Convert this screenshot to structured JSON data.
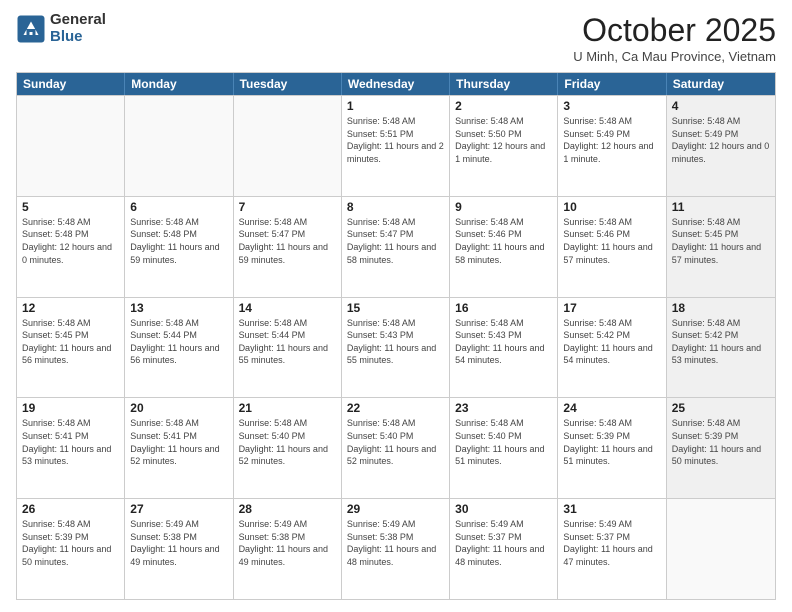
{
  "logo": {
    "general": "General",
    "blue": "Blue"
  },
  "title": "October 2025",
  "location": "U Minh, Ca Mau Province, Vietnam",
  "days_of_week": [
    "Sunday",
    "Monday",
    "Tuesday",
    "Wednesday",
    "Thursday",
    "Friday",
    "Saturday"
  ],
  "rows": [
    [
      {
        "day": "",
        "sunrise": "",
        "sunset": "",
        "daylight": "",
        "shaded": false,
        "empty": true
      },
      {
        "day": "",
        "sunrise": "",
        "sunset": "",
        "daylight": "",
        "shaded": false,
        "empty": true
      },
      {
        "day": "",
        "sunrise": "",
        "sunset": "",
        "daylight": "",
        "shaded": false,
        "empty": true
      },
      {
        "day": "1",
        "sunrise": "Sunrise: 5:48 AM",
        "sunset": "Sunset: 5:51 PM",
        "daylight": "Daylight: 11 hours and 2 minutes.",
        "shaded": false,
        "empty": false
      },
      {
        "day": "2",
        "sunrise": "Sunrise: 5:48 AM",
        "sunset": "Sunset: 5:50 PM",
        "daylight": "Daylight: 12 hours and 1 minute.",
        "shaded": false,
        "empty": false
      },
      {
        "day": "3",
        "sunrise": "Sunrise: 5:48 AM",
        "sunset": "Sunset: 5:49 PM",
        "daylight": "Daylight: 12 hours and 1 minute.",
        "shaded": false,
        "empty": false
      },
      {
        "day": "4",
        "sunrise": "Sunrise: 5:48 AM",
        "sunset": "Sunset: 5:49 PM",
        "daylight": "Daylight: 12 hours and 0 minutes.",
        "shaded": true,
        "empty": false
      }
    ],
    [
      {
        "day": "5",
        "sunrise": "Sunrise: 5:48 AM",
        "sunset": "Sunset: 5:48 PM",
        "daylight": "Daylight: 12 hours and 0 minutes.",
        "shaded": false,
        "empty": false
      },
      {
        "day": "6",
        "sunrise": "Sunrise: 5:48 AM",
        "sunset": "Sunset: 5:48 PM",
        "daylight": "Daylight: 11 hours and 59 minutes.",
        "shaded": false,
        "empty": false
      },
      {
        "day": "7",
        "sunrise": "Sunrise: 5:48 AM",
        "sunset": "Sunset: 5:47 PM",
        "daylight": "Daylight: 11 hours and 59 minutes.",
        "shaded": false,
        "empty": false
      },
      {
        "day": "8",
        "sunrise": "Sunrise: 5:48 AM",
        "sunset": "Sunset: 5:47 PM",
        "daylight": "Daylight: 11 hours and 58 minutes.",
        "shaded": false,
        "empty": false
      },
      {
        "day": "9",
        "sunrise": "Sunrise: 5:48 AM",
        "sunset": "Sunset: 5:46 PM",
        "daylight": "Daylight: 11 hours and 58 minutes.",
        "shaded": false,
        "empty": false
      },
      {
        "day": "10",
        "sunrise": "Sunrise: 5:48 AM",
        "sunset": "Sunset: 5:46 PM",
        "daylight": "Daylight: 11 hours and 57 minutes.",
        "shaded": false,
        "empty": false
      },
      {
        "day": "11",
        "sunrise": "Sunrise: 5:48 AM",
        "sunset": "Sunset: 5:45 PM",
        "daylight": "Daylight: 11 hours and 57 minutes.",
        "shaded": true,
        "empty": false
      }
    ],
    [
      {
        "day": "12",
        "sunrise": "Sunrise: 5:48 AM",
        "sunset": "Sunset: 5:45 PM",
        "daylight": "Daylight: 11 hours and 56 minutes.",
        "shaded": false,
        "empty": false
      },
      {
        "day": "13",
        "sunrise": "Sunrise: 5:48 AM",
        "sunset": "Sunset: 5:44 PM",
        "daylight": "Daylight: 11 hours and 56 minutes.",
        "shaded": false,
        "empty": false
      },
      {
        "day": "14",
        "sunrise": "Sunrise: 5:48 AM",
        "sunset": "Sunset: 5:44 PM",
        "daylight": "Daylight: 11 hours and 55 minutes.",
        "shaded": false,
        "empty": false
      },
      {
        "day": "15",
        "sunrise": "Sunrise: 5:48 AM",
        "sunset": "Sunset: 5:43 PM",
        "daylight": "Daylight: 11 hours and 55 minutes.",
        "shaded": false,
        "empty": false
      },
      {
        "day": "16",
        "sunrise": "Sunrise: 5:48 AM",
        "sunset": "Sunset: 5:43 PM",
        "daylight": "Daylight: 11 hours and 54 minutes.",
        "shaded": false,
        "empty": false
      },
      {
        "day": "17",
        "sunrise": "Sunrise: 5:48 AM",
        "sunset": "Sunset: 5:42 PM",
        "daylight": "Daylight: 11 hours and 54 minutes.",
        "shaded": false,
        "empty": false
      },
      {
        "day": "18",
        "sunrise": "Sunrise: 5:48 AM",
        "sunset": "Sunset: 5:42 PM",
        "daylight": "Daylight: 11 hours and 53 minutes.",
        "shaded": true,
        "empty": false
      }
    ],
    [
      {
        "day": "19",
        "sunrise": "Sunrise: 5:48 AM",
        "sunset": "Sunset: 5:41 PM",
        "daylight": "Daylight: 11 hours and 53 minutes.",
        "shaded": false,
        "empty": false
      },
      {
        "day": "20",
        "sunrise": "Sunrise: 5:48 AM",
        "sunset": "Sunset: 5:41 PM",
        "daylight": "Daylight: 11 hours and 52 minutes.",
        "shaded": false,
        "empty": false
      },
      {
        "day": "21",
        "sunrise": "Sunrise: 5:48 AM",
        "sunset": "Sunset: 5:40 PM",
        "daylight": "Daylight: 11 hours and 52 minutes.",
        "shaded": false,
        "empty": false
      },
      {
        "day": "22",
        "sunrise": "Sunrise: 5:48 AM",
        "sunset": "Sunset: 5:40 PM",
        "daylight": "Daylight: 11 hours and 52 minutes.",
        "shaded": false,
        "empty": false
      },
      {
        "day": "23",
        "sunrise": "Sunrise: 5:48 AM",
        "sunset": "Sunset: 5:40 PM",
        "daylight": "Daylight: 11 hours and 51 minutes.",
        "shaded": false,
        "empty": false
      },
      {
        "day": "24",
        "sunrise": "Sunrise: 5:48 AM",
        "sunset": "Sunset: 5:39 PM",
        "daylight": "Daylight: 11 hours and 51 minutes.",
        "shaded": false,
        "empty": false
      },
      {
        "day": "25",
        "sunrise": "Sunrise: 5:48 AM",
        "sunset": "Sunset: 5:39 PM",
        "daylight": "Daylight: 11 hours and 50 minutes.",
        "shaded": true,
        "empty": false
      }
    ],
    [
      {
        "day": "26",
        "sunrise": "Sunrise: 5:48 AM",
        "sunset": "Sunset: 5:39 PM",
        "daylight": "Daylight: 11 hours and 50 minutes.",
        "shaded": false,
        "empty": false
      },
      {
        "day": "27",
        "sunrise": "Sunrise: 5:49 AM",
        "sunset": "Sunset: 5:38 PM",
        "daylight": "Daylight: 11 hours and 49 minutes.",
        "shaded": false,
        "empty": false
      },
      {
        "day": "28",
        "sunrise": "Sunrise: 5:49 AM",
        "sunset": "Sunset: 5:38 PM",
        "daylight": "Daylight: 11 hours and 49 minutes.",
        "shaded": false,
        "empty": false
      },
      {
        "day": "29",
        "sunrise": "Sunrise: 5:49 AM",
        "sunset": "Sunset: 5:38 PM",
        "daylight": "Daylight: 11 hours and 48 minutes.",
        "shaded": false,
        "empty": false
      },
      {
        "day": "30",
        "sunrise": "Sunrise: 5:49 AM",
        "sunset": "Sunset: 5:37 PM",
        "daylight": "Daylight: 11 hours and 48 minutes.",
        "shaded": false,
        "empty": false
      },
      {
        "day": "31",
        "sunrise": "Sunrise: 5:49 AM",
        "sunset": "Sunset: 5:37 PM",
        "daylight": "Daylight: 11 hours and 47 minutes.",
        "shaded": false,
        "empty": false
      },
      {
        "day": "",
        "sunrise": "",
        "sunset": "",
        "daylight": "",
        "shaded": true,
        "empty": true
      }
    ]
  ]
}
